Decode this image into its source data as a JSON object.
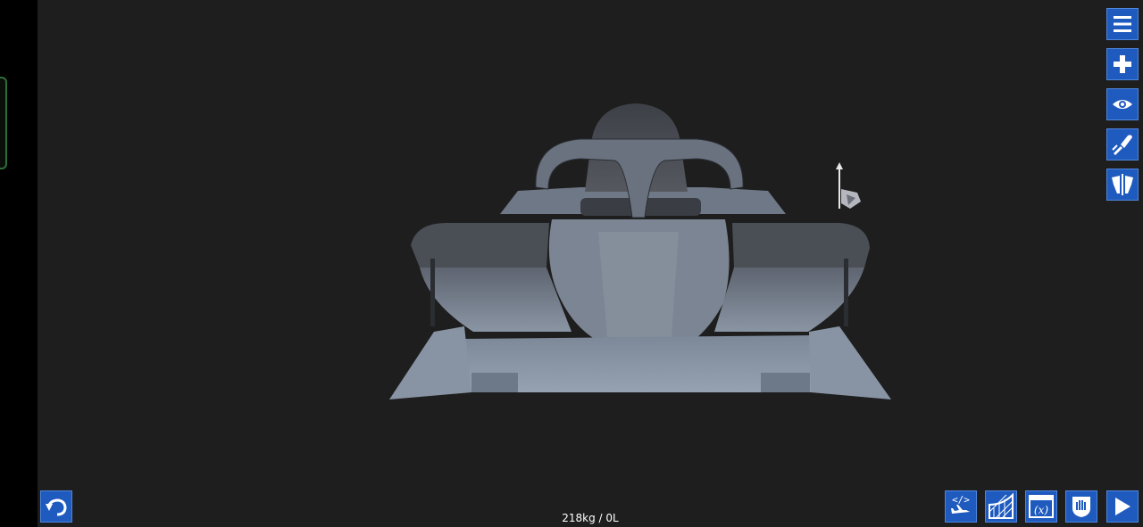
{
  "status": {
    "mass_fuel": "218kg / 0L"
  },
  "toolbar_right": [
    {
      "name": "menu-icon"
    },
    {
      "name": "add-part-icon"
    },
    {
      "name": "view-icon"
    },
    {
      "name": "paint-icon"
    },
    {
      "name": "symmetry-icon"
    }
  ],
  "toolbar_bottom": [
    {
      "name": "xml-aircraft-icon"
    },
    {
      "name": "grid-ruler-icon"
    },
    {
      "name": "variables-icon"
    },
    {
      "name": "hand-shield-icon"
    },
    {
      "name": "play-icon"
    }
  ],
  "colors": {
    "button_bg": "#1f5bbf",
    "viewport_bg": "#1e1e1e",
    "model_body": "#6b7380"
  }
}
